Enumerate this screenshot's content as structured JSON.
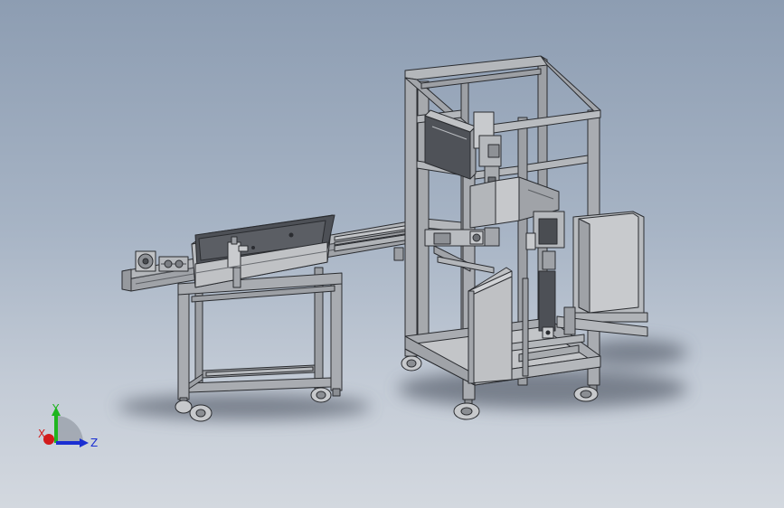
{
  "viewport": {
    "background_top": "#8d9db2",
    "background_bottom": "#d3d8df",
    "model_fill": "#a9acb1",
    "model_edge": "#2a2c30",
    "shadow_color": "#5f6673"
  },
  "triad": {
    "x_label": "X",
    "y_label": "Y",
    "z_label": "Z",
    "x_color": "#d21b1b",
    "y_color": "#1fb51f",
    "z_color": "#1b2fd2"
  }
}
